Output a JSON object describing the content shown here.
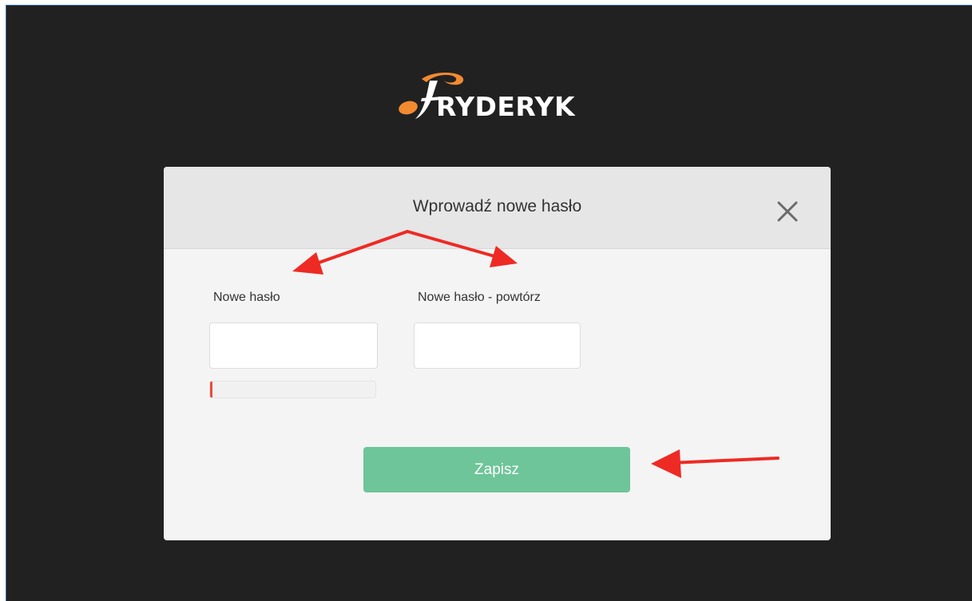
{
  "brand": {
    "name": "RYDERYK",
    "logo_letter": "F",
    "logo_accent_color": "#f28a30"
  },
  "dialog": {
    "title": "Wprowadź nowe hasło",
    "close_icon": "close-icon",
    "fields": [
      {
        "label": "Nowe hasło",
        "value": "",
        "placeholder": ""
      },
      {
        "label": "Nowe hasło - powtórz",
        "value": "",
        "placeholder": ""
      }
    ],
    "password_strength": 0.01,
    "save_label": "Zapisz"
  },
  "colors": {
    "background": "#212121",
    "modal_body": "#f4f4f4",
    "modal_header": "#e6e6e6",
    "save_button": "#6ec599",
    "strength_low": "#e74c3c",
    "annotation_arrow": "#ee2a24"
  },
  "annotations": {
    "arrows": [
      "arrow-to-new-password",
      "arrow-to-repeat-password",
      "arrow-to-save-button"
    ]
  }
}
